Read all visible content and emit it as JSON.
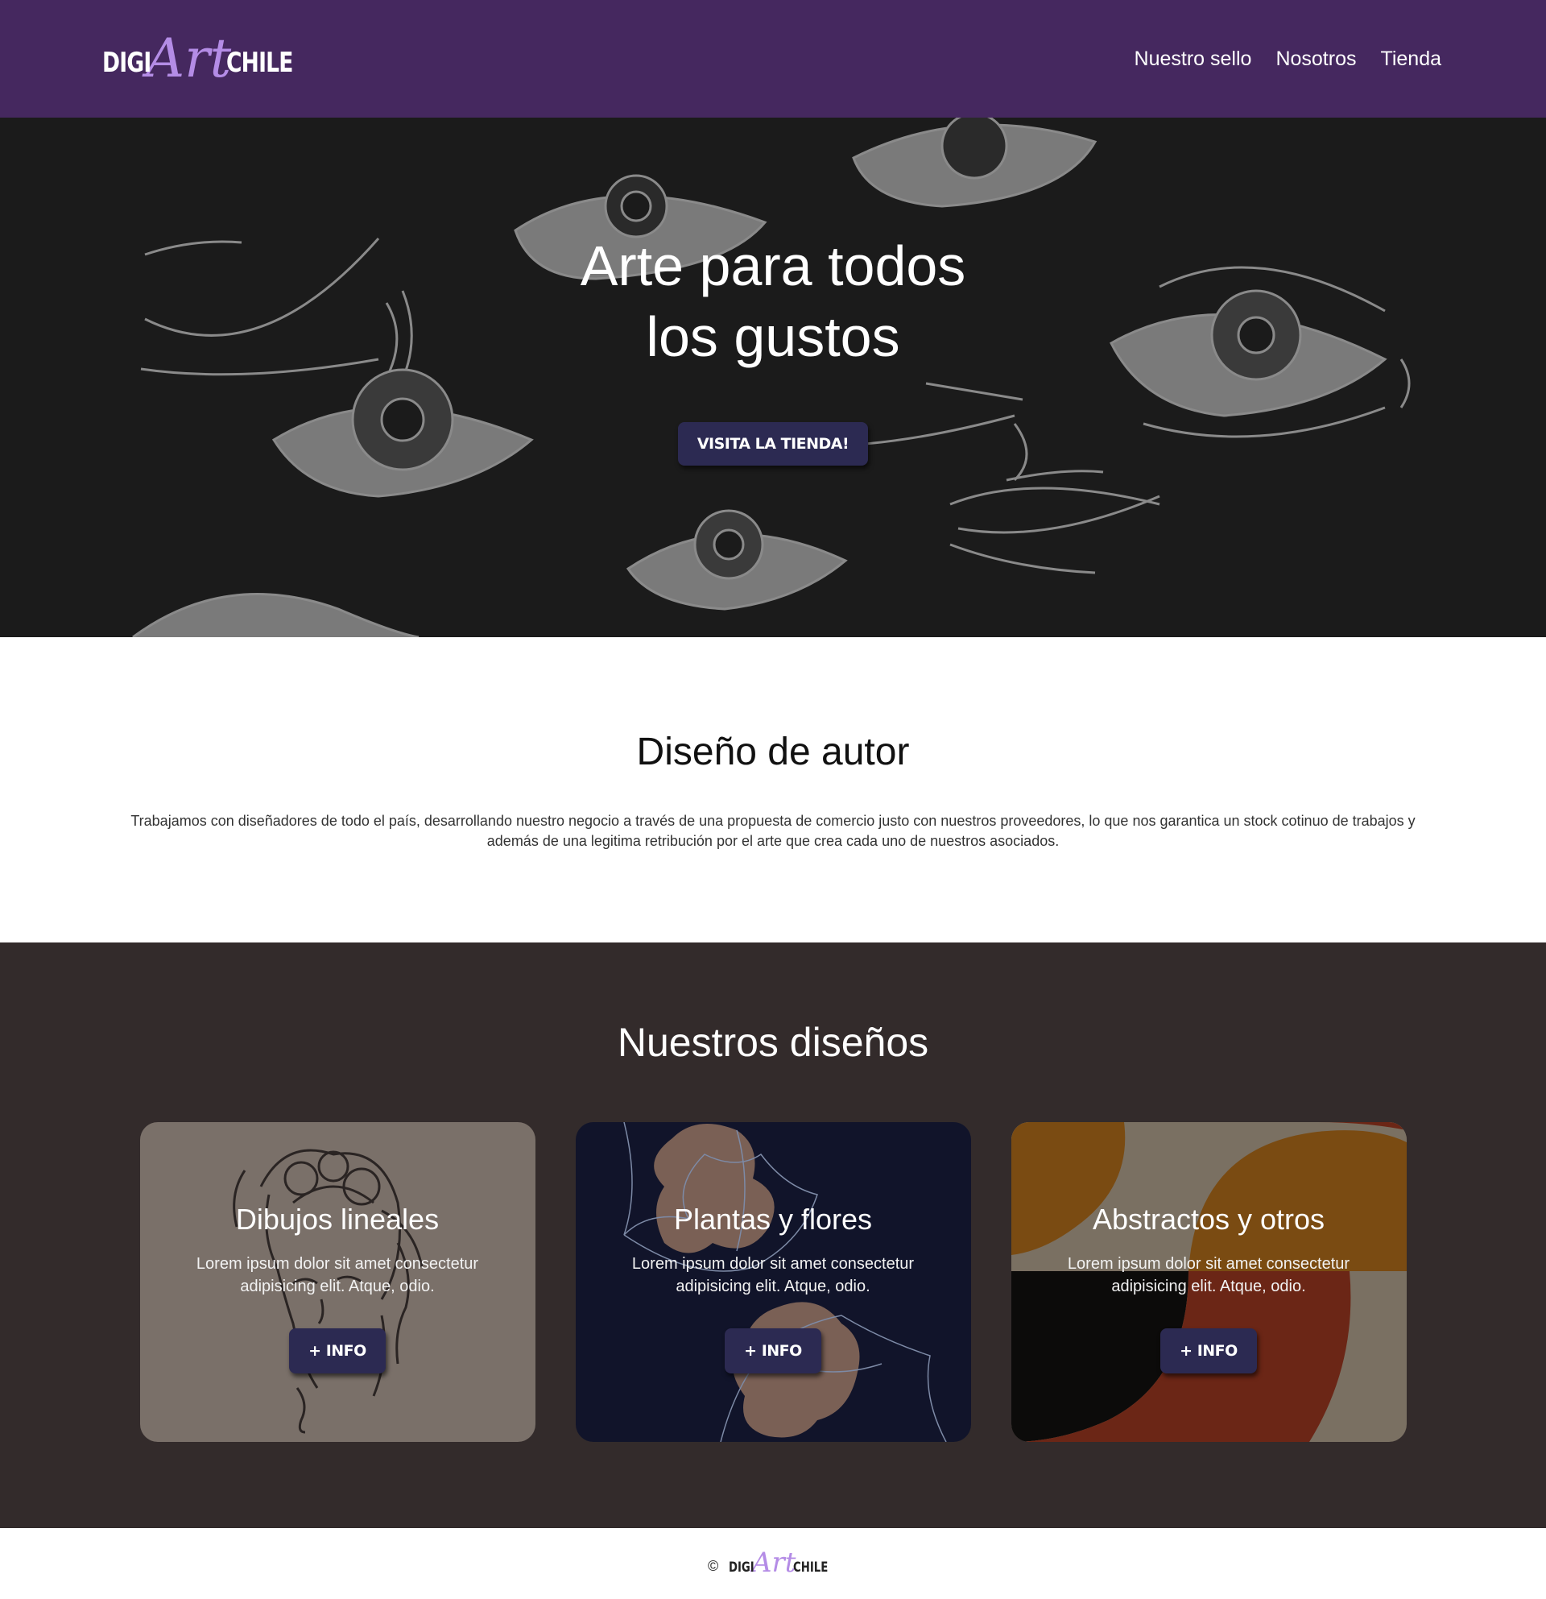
{
  "brand": {
    "prefix": "DIGI",
    "script": "Art",
    "suffix": "CHILE",
    "accent_color": "#b48ce6"
  },
  "nav": {
    "background": "#45285f",
    "links": [
      "Nuestro sello",
      "Nosotros",
      "Tienda"
    ]
  },
  "hero": {
    "title_line1": "Arte para todos",
    "title_line2": "los gustos",
    "button_label": "VISITA LA TIENDA!"
  },
  "about": {
    "title": "Diseño de autor",
    "text": "Trabajamos con diseñadores de todo el país, desarrollando nuestro negocio a través de una propuesta de comercio justo con nuestros proveedores, lo que nos garantica un stock cotinuo de trabajos y además de una legitima retribución por el arte que crea cada uno de nuestros asociados."
  },
  "designs": {
    "title": "Nuestros diseños",
    "cards": [
      {
        "title": "Dibujos lineales",
        "text": "Lorem ipsum dolor sit amet consectetur adipisicing elit. Atque, odio.",
        "button_label": "+ INFO"
      },
      {
        "title": "Plantas y flores",
        "text": "Lorem ipsum dolor sit amet consectetur adipisicing elit. Atque, odio.",
        "button_label": "+ INFO"
      },
      {
        "title": "Abstractos y otros",
        "text": "Lorem ipsum dolor sit amet consectetur adipisicing elit. Atque, odio.",
        "button_label": "+ INFO"
      }
    ]
  },
  "footer": {
    "copyright_symbol": "©"
  }
}
